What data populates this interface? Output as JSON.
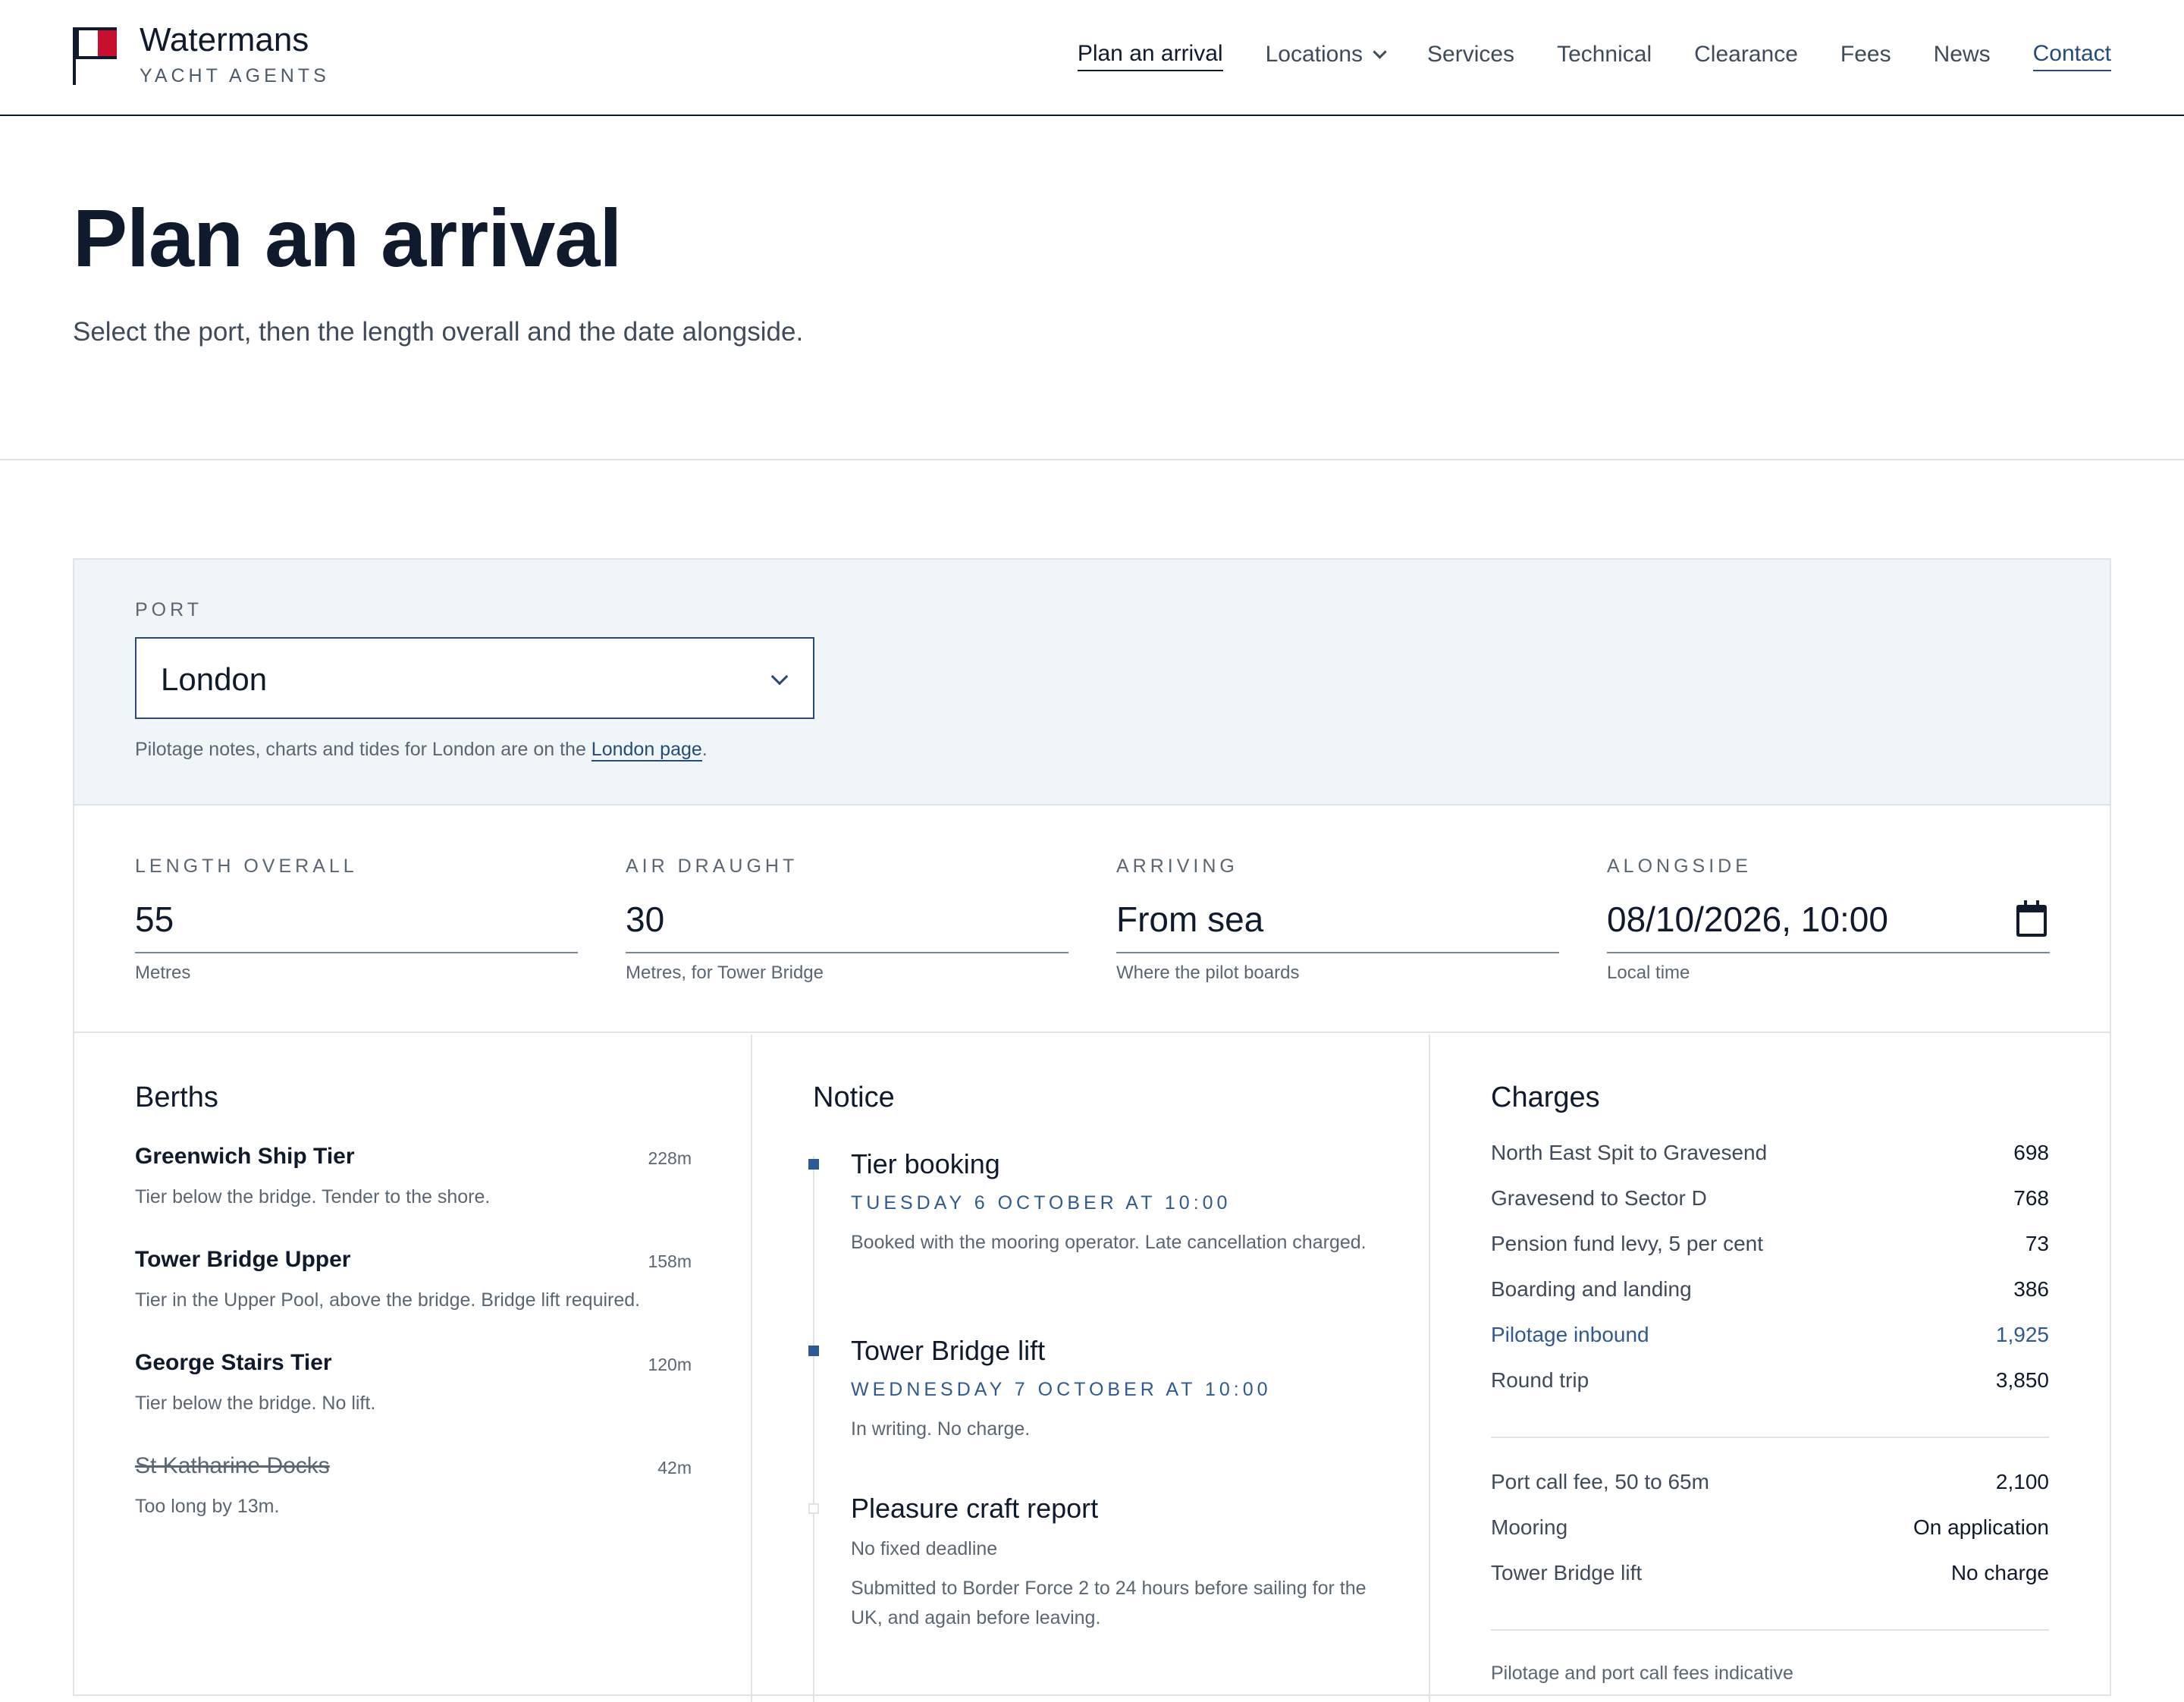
{
  "header": {
    "brand": "Watermans",
    "brand_sub": "YACHT AGENTS",
    "nav": [
      {
        "label": "Plan an arrival"
      },
      {
        "label": "Locations"
      },
      {
        "label": "Services"
      },
      {
        "label": "Technical"
      },
      {
        "label": "Clearance"
      },
      {
        "label": "Fees"
      },
      {
        "label": "News"
      },
      {
        "label": "Contact"
      }
    ]
  },
  "hero": {
    "title": "Plan an arrival",
    "subtitle": "Select the port, then the length overall and the date alongside."
  },
  "port": {
    "label": "PORT",
    "value": "London",
    "note_prefix": "Pilotage notes, charts and tides for London are on the ",
    "note_link": "London page",
    "note_suffix": "."
  },
  "fields": {
    "loa": {
      "label": "LENGTH OVERALL",
      "value": "55",
      "hint": "Metres"
    },
    "air": {
      "label": "AIR DRAUGHT",
      "value": "30",
      "hint": "Metres, for Tower Bridge"
    },
    "arriving": {
      "label": "ARRIVING",
      "value": "From sea",
      "hint": "Where the pilot boards"
    },
    "alongside": {
      "label": "ALONGSIDE",
      "value": "08/10/2026, 10:00",
      "hint": "Local time"
    }
  },
  "berths": {
    "title": "Berths",
    "items": [
      {
        "name": "Greenwich Ship Tier",
        "length": "228m",
        "desc": "Tier below the bridge. Tender to the shore."
      },
      {
        "name": "Tower Bridge Upper",
        "length": "158m",
        "desc": "Tier in the Upper Pool, above the bridge. Bridge lift required."
      },
      {
        "name": "George Stairs Tier",
        "length": "120m",
        "desc": "Tier below the bridge. No lift."
      },
      {
        "name": "St Katharine Docks",
        "length": "42m",
        "desc": "Too long by 13m."
      }
    ]
  },
  "notice": {
    "title": "Notice",
    "items": [
      {
        "title": "Tier booking",
        "when": "TUESDAY 6 OCTOBER AT 10:00",
        "body": "Booked with the mooring operator. Late cancellation charged."
      },
      {
        "title": "Tower Bridge lift",
        "when": "WEDNESDAY 7 OCTOBER AT 10:00",
        "body": "In writing. No charge."
      },
      {
        "title": "Pleasure craft report",
        "plain": "No fixed deadline",
        "body": "Submitted to Border Force 2 to 24 hours before sailing for the UK, and again before leaving."
      }
    ]
  },
  "charges": {
    "title": "Charges",
    "group1": [
      {
        "label": "North East Spit to Gravesend",
        "value": "698"
      },
      {
        "label": "Gravesend to Sector D",
        "value": "768"
      },
      {
        "label": "Pension fund levy, 5 per cent",
        "value": "73"
      },
      {
        "label": "Boarding and landing",
        "value": "386"
      },
      {
        "label": "Pilotage inbound",
        "value": "1,925"
      },
      {
        "label": "Round trip",
        "value": "3,850"
      }
    ],
    "group2": [
      {
        "label": "Port call fee, 50 to 65m",
        "value": "2,100"
      },
      {
        "label": "Mooring",
        "value": "On application"
      },
      {
        "label": "Tower Bridge lift",
        "value": "No charge"
      }
    ],
    "footnote": "Pilotage and port call fees indicative"
  },
  "colors": {
    "navy": "#0f1b2d",
    "accent": "#2e5a93",
    "flag_red": "#c8102e",
    "panel": "#f0f5f8"
  }
}
